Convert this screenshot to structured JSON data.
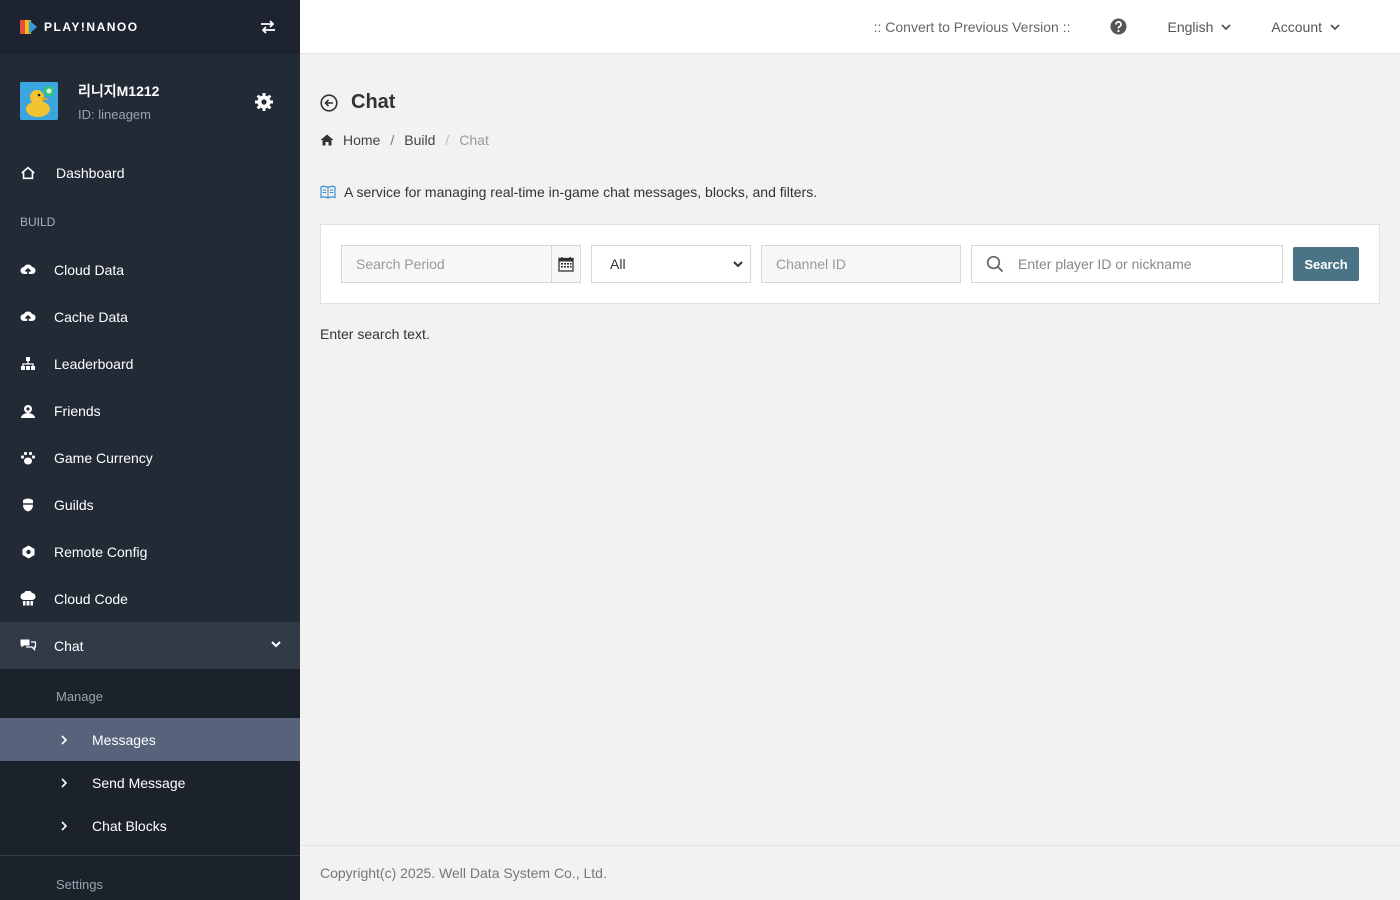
{
  "brand": {
    "logo_text": "PLAY!NANOO"
  },
  "profile": {
    "name": "리니지M1212",
    "id_text": "ID: lineagem"
  },
  "sidebar": {
    "dashboard": "Dashboard",
    "section_build": "BUILD",
    "items": [
      {
        "label": "Cloud Data",
        "icon": "cloud-upload-icon"
      },
      {
        "label": "Cache Data",
        "icon": "cloud-upload-icon"
      },
      {
        "label": "Leaderboard",
        "icon": "sitemap-icon"
      },
      {
        "label": "Friends",
        "icon": "friends-icon"
      },
      {
        "label": "Game Currency",
        "icon": "paw-icon"
      },
      {
        "label": "Guilds",
        "icon": "shield-icon"
      },
      {
        "label": "Remote Config",
        "icon": "cog-box-icon"
      },
      {
        "label": "Cloud Code",
        "icon": "cloud-code-icon"
      }
    ],
    "chat": {
      "label": "Chat",
      "section_manage": "Manage",
      "sub_items": [
        "Messages",
        "Send Message",
        "Chat Blocks"
      ],
      "section_settings": "Settings"
    }
  },
  "topbar": {
    "convert": ":: Convert to Previous Version ::",
    "language": "English",
    "account": "Account"
  },
  "page": {
    "title": "Chat",
    "breadcrumb": [
      "Home",
      "Build",
      "Chat"
    ],
    "description": "A service for managing real-time in-game chat messages, blocks, and filters."
  },
  "search": {
    "period_placeholder": "Search Period",
    "filter_value": "All",
    "channel_placeholder": "Channel ID",
    "player_placeholder": "Enter player ID or nickname",
    "button": "Search"
  },
  "results": {
    "empty_text": "Enter search text."
  },
  "footer": {
    "copyright": "Copyright(c) 2025. Well Data System Co., Ltd."
  },
  "colors": {
    "sidebar_bg": "#222a36",
    "active_sub": "#56637b",
    "search_button": "#4a7385"
  }
}
